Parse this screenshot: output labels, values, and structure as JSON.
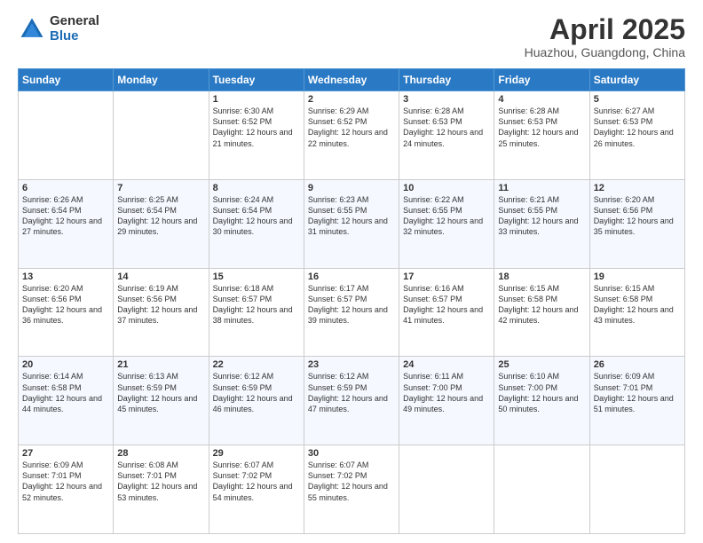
{
  "header": {
    "logo_general": "General",
    "logo_blue": "Blue",
    "title": "April 2025",
    "subtitle": "Huazhou, Guangdong, China"
  },
  "weekdays": [
    "Sunday",
    "Monday",
    "Tuesday",
    "Wednesday",
    "Thursday",
    "Friday",
    "Saturday"
  ],
  "weeks": [
    [
      {
        "day": "",
        "detail": ""
      },
      {
        "day": "",
        "detail": ""
      },
      {
        "day": "1",
        "detail": "Sunrise: 6:30 AM\nSunset: 6:52 PM\nDaylight: 12 hours and 21 minutes."
      },
      {
        "day": "2",
        "detail": "Sunrise: 6:29 AM\nSunset: 6:52 PM\nDaylight: 12 hours and 22 minutes."
      },
      {
        "day": "3",
        "detail": "Sunrise: 6:28 AM\nSunset: 6:53 PM\nDaylight: 12 hours and 24 minutes."
      },
      {
        "day": "4",
        "detail": "Sunrise: 6:28 AM\nSunset: 6:53 PM\nDaylight: 12 hours and 25 minutes."
      },
      {
        "day": "5",
        "detail": "Sunrise: 6:27 AM\nSunset: 6:53 PM\nDaylight: 12 hours and 26 minutes."
      }
    ],
    [
      {
        "day": "6",
        "detail": "Sunrise: 6:26 AM\nSunset: 6:54 PM\nDaylight: 12 hours and 27 minutes."
      },
      {
        "day": "7",
        "detail": "Sunrise: 6:25 AM\nSunset: 6:54 PM\nDaylight: 12 hours and 29 minutes."
      },
      {
        "day": "8",
        "detail": "Sunrise: 6:24 AM\nSunset: 6:54 PM\nDaylight: 12 hours and 30 minutes."
      },
      {
        "day": "9",
        "detail": "Sunrise: 6:23 AM\nSunset: 6:55 PM\nDaylight: 12 hours and 31 minutes."
      },
      {
        "day": "10",
        "detail": "Sunrise: 6:22 AM\nSunset: 6:55 PM\nDaylight: 12 hours and 32 minutes."
      },
      {
        "day": "11",
        "detail": "Sunrise: 6:21 AM\nSunset: 6:55 PM\nDaylight: 12 hours and 33 minutes."
      },
      {
        "day": "12",
        "detail": "Sunrise: 6:20 AM\nSunset: 6:56 PM\nDaylight: 12 hours and 35 minutes."
      }
    ],
    [
      {
        "day": "13",
        "detail": "Sunrise: 6:20 AM\nSunset: 6:56 PM\nDaylight: 12 hours and 36 minutes."
      },
      {
        "day": "14",
        "detail": "Sunrise: 6:19 AM\nSunset: 6:56 PM\nDaylight: 12 hours and 37 minutes."
      },
      {
        "day": "15",
        "detail": "Sunrise: 6:18 AM\nSunset: 6:57 PM\nDaylight: 12 hours and 38 minutes."
      },
      {
        "day": "16",
        "detail": "Sunrise: 6:17 AM\nSunset: 6:57 PM\nDaylight: 12 hours and 39 minutes."
      },
      {
        "day": "17",
        "detail": "Sunrise: 6:16 AM\nSunset: 6:57 PM\nDaylight: 12 hours and 41 minutes."
      },
      {
        "day": "18",
        "detail": "Sunrise: 6:15 AM\nSunset: 6:58 PM\nDaylight: 12 hours and 42 minutes."
      },
      {
        "day": "19",
        "detail": "Sunrise: 6:15 AM\nSunset: 6:58 PM\nDaylight: 12 hours and 43 minutes."
      }
    ],
    [
      {
        "day": "20",
        "detail": "Sunrise: 6:14 AM\nSunset: 6:58 PM\nDaylight: 12 hours and 44 minutes."
      },
      {
        "day": "21",
        "detail": "Sunrise: 6:13 AM\nSunset: 6:59 PM\nDaylight: 12 hours and 45 minutes."
      },
      {
        "day": "22",
        "detail": "Sunrise: 6:12 AM\nSunset: 6:59 PM\nDaylight: 12 hours and 46 minutes."
      },
      {
        "day": "23",
        "detail": "Sunrise: 6:12 AM\nSunset: 6:59 PM\nDaylight: 12 hours and 47 minutes."
      },
      {
        "day": "24",
        "detail": "Sunrise: 6:11 AM\nSunset: 7:00 PM\nDaylight: 12 hours and 49 minutes."
      },
      {
        "day": "25",
        "detail": "Sunrise: 6:10 AM\nSunset: 7:00 PM\nDaylight: 12 hours and 50 minutes."
      },
      {
        "day": "26",
        "detail": "Sunrise: 6:09 AM\nSunset: 7:01 PM\nDaylight: 12 hours and 51 minutes."
      }
    ],
    [
      {
        "day": "27",
        "detail": "Sunrise: 6:09 AM\nSunset: 7:01 PM\nDaylight: 12 hours and 52 minutes."
      },
      {
        "day": "28",
        "detail": "Sunrise: 6:08 AM\nSunset: 7:01 PM\nDaylight: 12 hours and 53 minutes."
      },
      {
        "day": "29",
        "detail": "Sunrise: 6:07 AM\nSunset: 7:02 PM\nDaylight: 12 hours and 54 minutes."
      },
      {
        "day": "30",
        "detail": "Sunrise: 6:07 AM\nSunset: 7:02 PM\nDaylight: 12 hours and 55 minutes."
      },
      {
        "day": "",
        "detail": ""
      },
      {
        "day": "",
        "detail": ""
      },
      {
        "day": "",
        "detail": ""
      }
    ]
  ]
}
